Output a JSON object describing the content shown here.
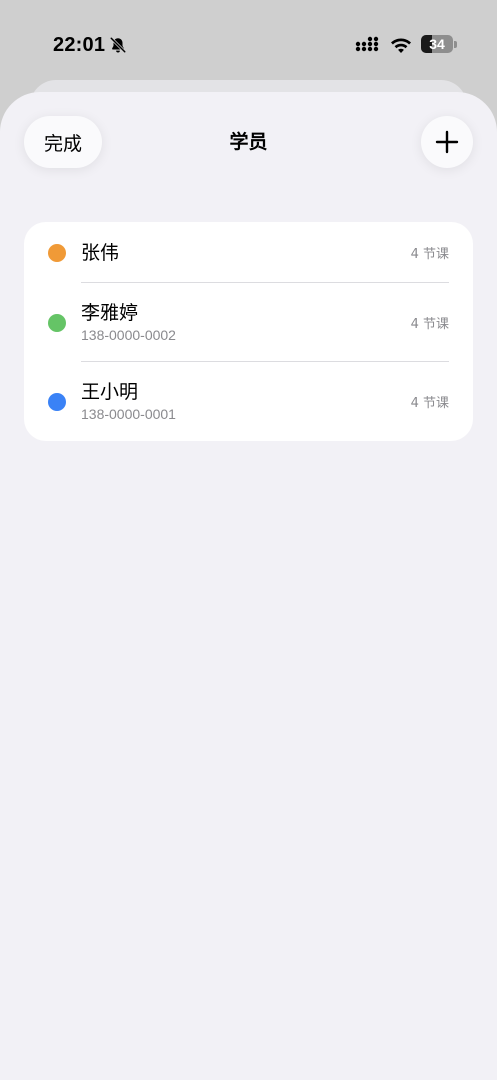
{
  "status_bar": {
    "time": "22:01",
    "battery_level": "34",
    "battery_fraction": 0.34
  },
  "icons": {
    "silent": "bell-slash-icon",
    "signal": "cellular-signal-icon",
    "wifi": "wifi-icon",
    "battery": "battery-icon",
    "add": "plus-icon"
  },
  "header": {
    "done_label": "完成",
    "title": "学员"
  },
  "students": [
    {
      "name": "张伟",
      "phone": "",
      "lessons": "4 节课",
      "color": "#f09a37"
    },
    {
      "name": "李雅婷",
      "phone": "138-0000-0002",
      "lessons": "4 节课",
      "color": "#65c466"
    },
    {
      "name": "王小明",
      "phone": "138-0000-0001",
      "lessons": "4 节课",
      "color": "#3a82f6"
    }
  ],
  "colors": {
    "sheet_background": "#f2f1f6",
    "card_background": "#ffffff",
    "secondary_text": "#8a8a8e"
  }
}
